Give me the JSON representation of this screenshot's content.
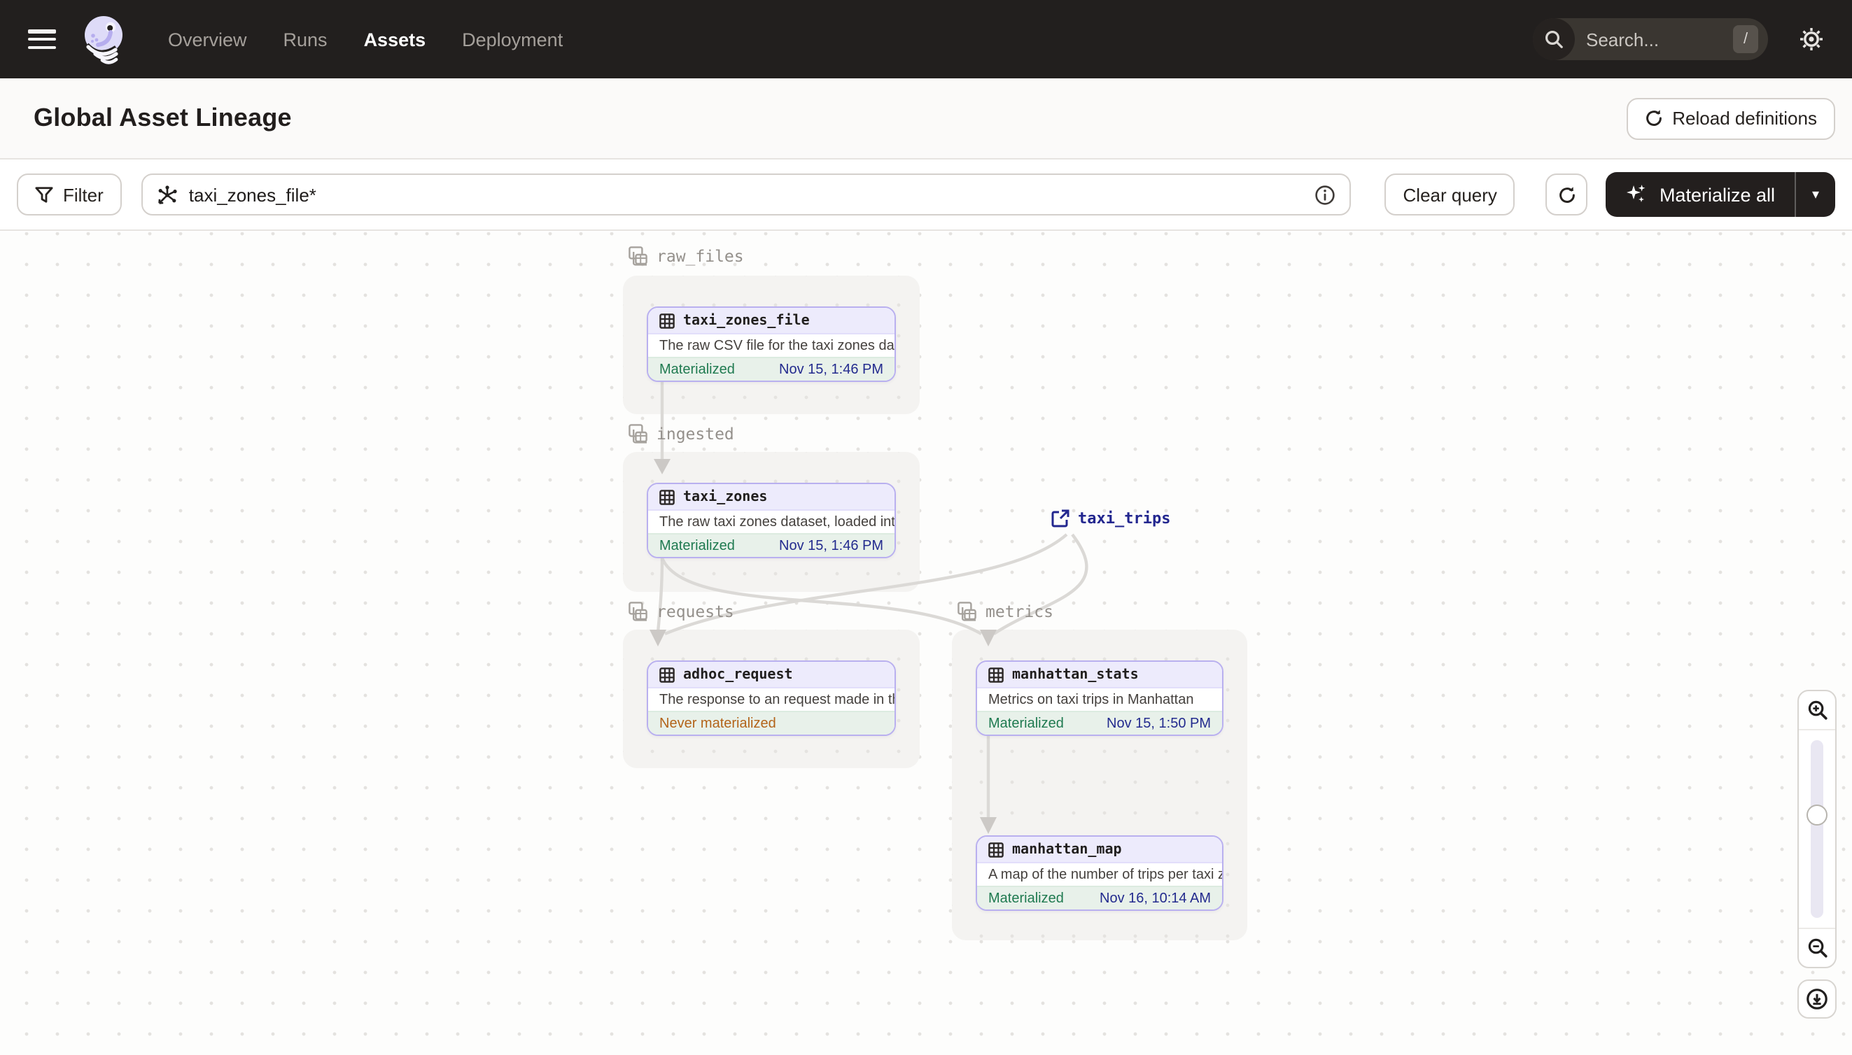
{
  "nav": {
    "items": [
      {
        "label": "Overview",
        "active": false
      },
      {
        "label": "Runs",
        "active": false
      },
      {
        "label": "Assets",
        "active": true
      },
      {
        "label": "Deployment",
        "active": false
      }
    ],
    "search": {
      "placeholder": "Search...",
      "shortcut": "/"
    }
  },
  "header": {
    "title": "Global Asset Lineage",
    "reload_button": "Reload definitions"
  },
  "toolbar": {
    "filter_label": "Filter",
    "query_value": "taxi_zones_file*",
    "clear_button": "Clear query",
    "materialize_button": "Materialize all"
  },
  "graph": {
    "groups": [
      {
        "name": "raw_files"
      },
      {
        "name": "ingested"
      },
      {
        "name": "requests"
      },
      {
        "name": "metrics"
      }
    ],
    "nodes": [
      {
        "name": "taxi_zones_file",
        "description": "The raw CSV file for the taxi zones dat...",
        "status": "Materialized",
        "timestamp": "Nov 15, 1:46 PM"
      },
      {
        "name": "taxi_zones",
        "description": "The raw taxi zones dataset, loaded int...",
        "status": "Materialized",
        "timestamp": "Nov 15, 1:46 PM"
      },
      {
        "name": "adhoc_request",
        "description": "The response to an request made in th...",
        "status": "Never materialized",
        "timestamp": ""
      },
      {
        "name": "manhattan_stats",
        "description": "Metrics on taxi trips in Manhattan",
        "status": "Materialized",
        "timestamp": "Nov 15, 1:50 PM"
      },
      {
        "name": "manhattan_map",
        "description": "A map of the number of trips per taxi z...",
        "status": "Materialized",
        "timestamp": "Nov 16, 10:14 AM"
      }
    ],
    "external_asset": {
      "name": "taxi_trips"
    }
  },
  "colors": {
    "navbar_bg": "#221f1e",
    "node_border_lavender": "#b9b0ef",
    "node_header_bg": "#edebfc",
    "materialized_green": "#1f7a50",
    "never_materialized_orange": "#b3641a",
    "timestamp_navy": "#232b8e",
    "edge_gray": "#dbd9d6"
  }
}
